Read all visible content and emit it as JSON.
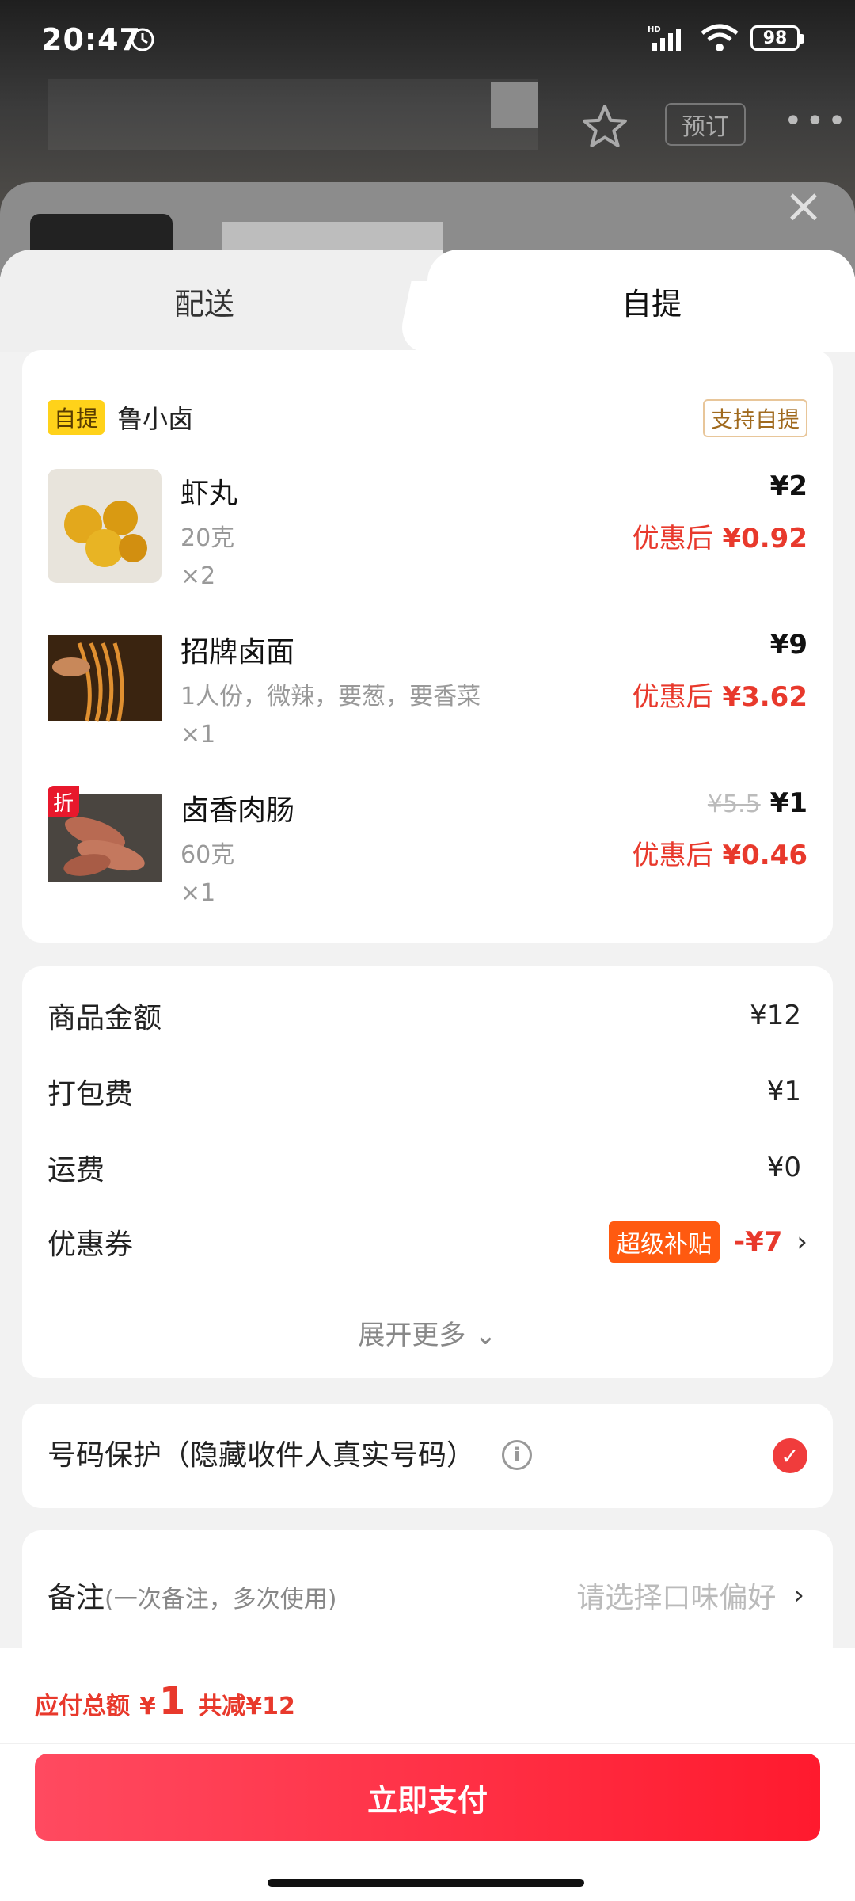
{
  "status_bar": {
    "time": "20:47",
    "battery": "98"
  },
  "header": {
    "preorder_label": "预订",
    "more_label": "•••"
  },
  "tabs": [
    {
      "label": "配送",
      "active": false
    },
    {
      "label": "自提",
      "active": true
    }
  ],
  "store": {
    "tag": "自提",
    "name": "鲁小卤",
    "support_tag": "支持自提"
  },
  "items": [
    {
      "name": "虾丸",
      "spec": "20克",
      "qty": "×2",
      "price": "¥2",
      "after_label": "优惠后",
      "after_price": "¥0.92"
    },
    {
      "name": "招牌卤面",
      "spec": "1人份，微辣，要葱，要香菜",
      "qty": "×1",
      "price": "¥9",
      "after_label": "优惠后",
      "after_price": "¥3.62"
    },
    {
      "name": "卤香肉肠",
      "spec": "60克",
      "qty": "×1",
      "orig_price": "¥5.5",
      "price": "¥1",
      "after_label": "优惠后",
      "after_price": "¥0.46",
      "badge": "折"
    }
  ],
  "fees": {
    "goods_label": "商品金额",
    "goods_value": "¥12",
    "pack_label": "打包费",
    "pack_value": "¥1",
    "ship_label": "运费",
    "ship_value": "¥0",
    "coupon_label": "优惠券",
    "coupon_tag": "超级补贴",
    "coupon_value": "-¥7",
    "expand_label": "展开更多 ⌄"
  },
  "privacy": {
    "label": "号码保护（隐藏收件人真实号码）",
    "checked": true
  },
  "remark": {
    "label": "备注",
    "sub": "(一次备注，多次使用)",
    "placeholder": "请选择口味偏好"
  },
  "footer": {
    "total_label": "应付总额",
    "currency": "¥",
    "total_amount": "1",
    "saved": "共减¥12",
    "pay_label": "立即支付"
  },
  "colors": {
    "accent_red": "#e8392c",
    "pay_button": "#ff1a2e",
    "pickup_tag": "#ffd21a",
    "super_tag": "#ff5a10"
  }
}
